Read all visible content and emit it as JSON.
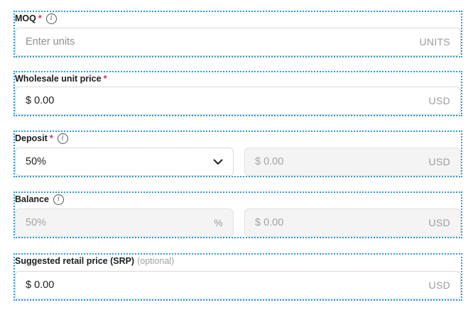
{
  "moq": {
    "label": "MOQ",
    "required_mark": "*",
    "info_glyph": "i",
    "placeholder": "Enter units",
    "suffix": "UNITS"
  },
  "wholesale": {
    "label": "Wholesale unit price",
    "required_mark": "*",
    "value": "$ 0.00",
    "suffix": "USD"
  },
  "deposit": {
    "label": "Deposit",
    "required_mark": "*",
    "info_glyph": "i",
    "selected_option": "50%",
    "amount_value": "$ 0.00",
    "amount_suffix": "USD"
  },
  "balance": {
    "label": "Balance",
    "info_glyph": "i",
    "percent_value": "50%",
    "percent_suffix": "%",
    "amount_value": "$ 0.00",
    "amount_suffix": "USD"
  },
  "srp": {
    "label": "Suggested retail price (SRP)",
    "optional_text": "(optional)",
    "value": "$ 0.00",
    "suffix": "USD"
  },
  "colors": {
    "accent_outline": "#2b9bd8",
    "required": "#e0245e"
  }
}
